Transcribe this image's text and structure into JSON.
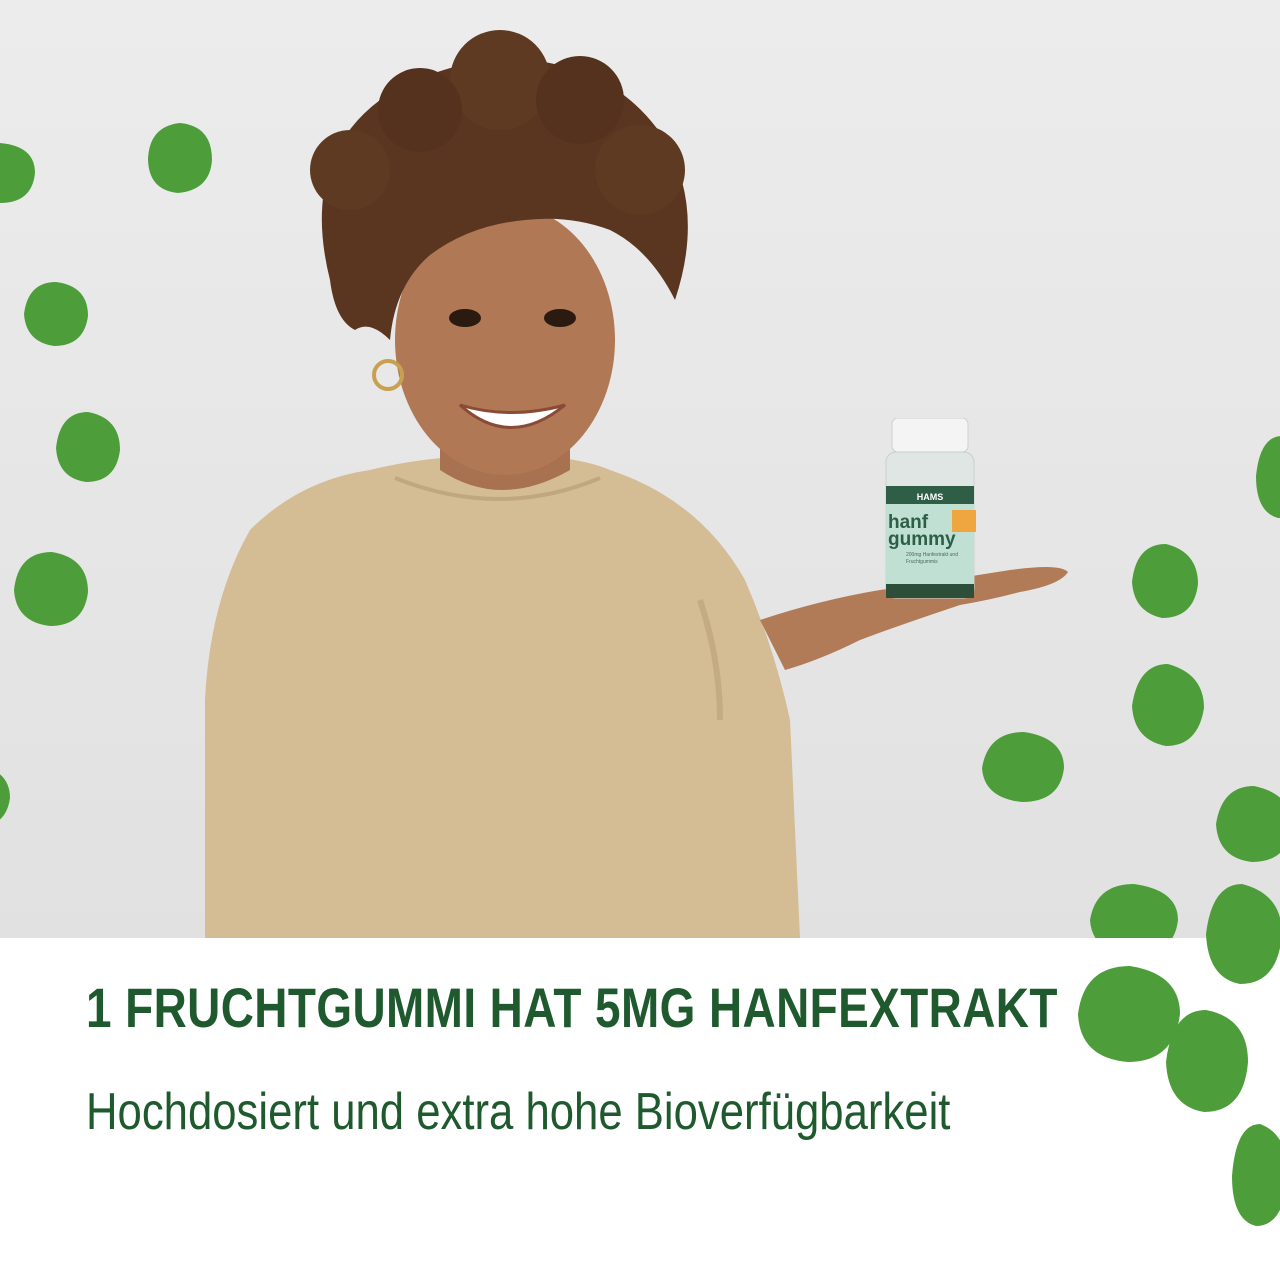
{
  "headline": "1 FRUCHTGUMMI HAT 5MG HANFEXTRAKT",
  "subline": "Hochdosiert und extra hohe Bioverfügbarkeit",
  "product": {
    "brand": "HAMS",
    "name_line1": "hanf",
    "name_line2": "gummy",
    "description": "200mg Hanfextrakt und Fruchtgummis"
  },
  "colors": {
    "text_green": "#1f5a2e",
    "gummy_green": "#4d9e3a",
    "background_gray": "#e8e8e8",
    "shirt_beige": "#d3bb94"
  }
}
